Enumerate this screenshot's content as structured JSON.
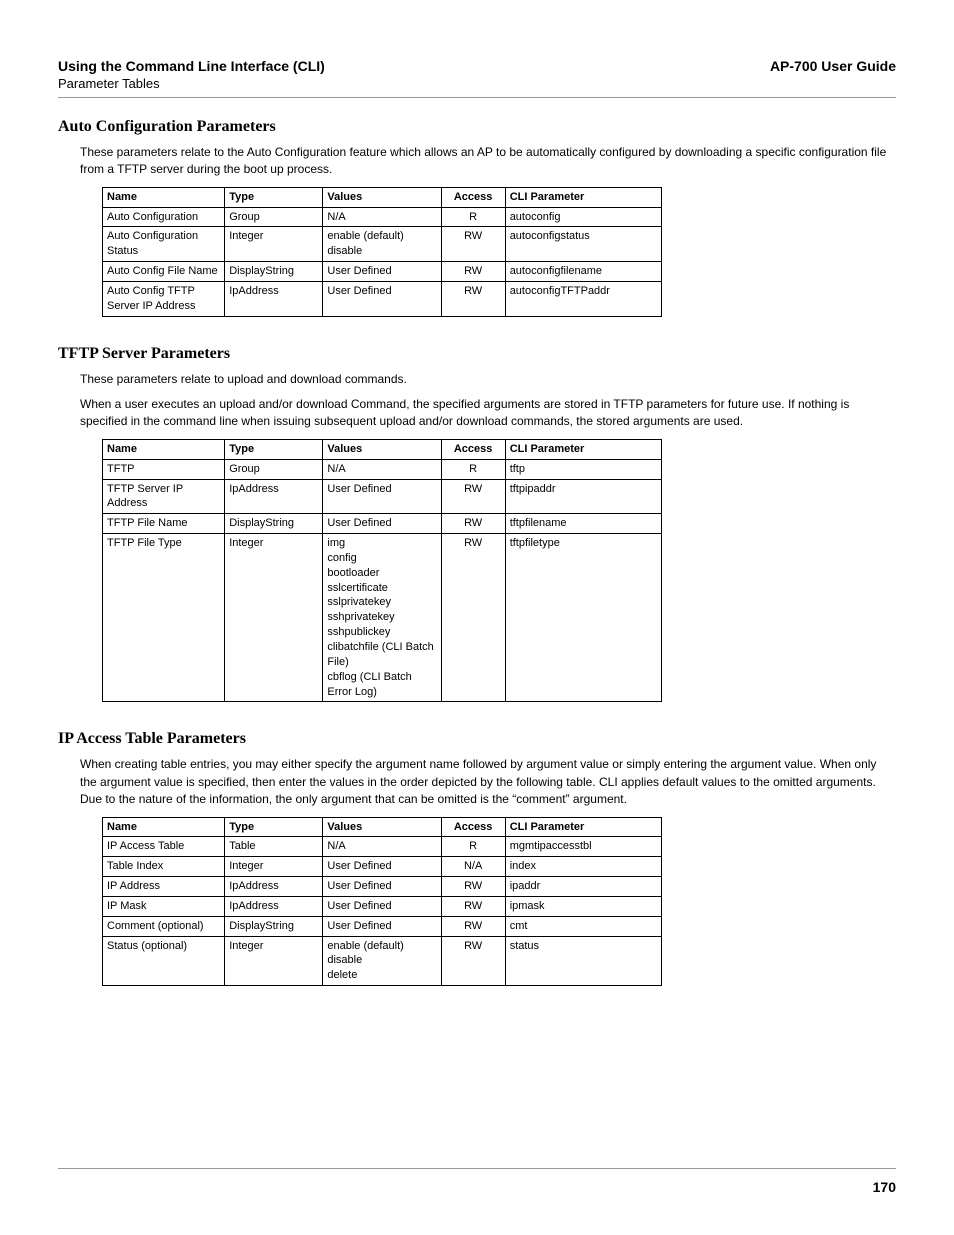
{
  "header": {
    "left_title": "Using the Command Line Interface (CLI)",
    "left_subtitle": "Parameter Tables",
    "right": "AP-700 User Guide"
  },
  "sections": [
    {
      "heading": "Auto Configuration Parameters",
      "paras": [
        "These parameters relate to the Auto Configuration feature which allows an AP to be automatically configured by downloading a specific configuration file from a TFTP server during the boot up process."
      ],
      "cols": [
        "Name",
        "Type",
        "Values",
        "Access",
        "CLI Parameter"
      ],
      "rows": [
        [
          "Auto Configuration",
          "Group",
          "N/A",
          "R",
          "autoconfig"
        ],
        [
          "Auto Configuration Status",
          "Integer",
          "enable (default)\ndisable",
          "RW",
          "autoconfigstatus"
        ],
        [
          "Auto Config File Name",
          "DisplayString",
          "User Defined",
          "RW",
          "autoconfigfilename"
        ],
        [
          "Auto Config TFTP Server IP Address",
          "IpAddress",
          "User Defined",
          "RW",
          "autoconfigTFTPaddr"
        ]
      ]
    },
    {
      "heading": "TFTP Server Parameters",
      "paras": [
        "These parameters relate to upload and download commands.",
        "When a user executes an upload and/or download Command, the specified arguments are stored in TFTP parameters for future use. If nothing is specified in the command line when issuing subsequent upload and/or download commands, the stored arguments are used."
      ],
      "cols": [
        "Name",
        "Type",
        "Values",
        "Access",
        "CLI Parameter"
      ],
      "rows": [
        [
          "TFTP",
          "Group",
          "N/A",
          "R",
          "tftp"
        ],
        [
          "TFTP Server IP Address",
          "IpAddress",
          "User Defined",
          "RW",
          "tftpipaddr"
        ],
        [
          "TFTP File Name",
          "DisplayString",
          "User Defined",
          "RW",
          "tftpfilename"
        ],
        [
          "TFTP File Type",
          "Integer",
          "img\nconfig\nbootloader\nsslcertificate\nsslprivatekey\nsshprivatekey\nsshpublickey\nclibatchfile (CLI Batch File)\ncbflog (CLI Batch Error Log)",
          "RW",
          "tftpfiletype"
        ]
      ]
    },
    {
      "heading": "IP Access Table Parameters",
      "paras": [
        "When creating table entries, you may either specify the argument name followed by argument value or simply entering the argument value. When only the argument value is specified, then enter the values in the order depicted by the following table. CLI applies default values to the omitted arguments. Due to the nature of the information, the only argument that can be omitted is the “comment” argument."
      ],
      "cols": [
        "Name",
        "Type",
        "Values",
        "Access",
        "CLI Parameter"
      ],
      "rows": [
        [
          "IP Access Table",
          "Table",
          "N/A",
          "R",
          "mgmtipaccesstbl"
        ],
        [
          "Table Index",
          "Integer",
          "User Defined",
          "N/A",
          "index"
        ],
        [
          "IP Address",
          "IpAddress",
          "User Defined",
          "RW",
          "ipaddr"
        ],
        [
          "IP Mask",
          "IpAddress",
          "User Defined",
          "RW",
          "ipmask"
        ],
        [
          "Comment (optional)",
          "DisplayString",
          "User Defined",
          "RW",
          "cmt"
        ],
        [
          "Status (optional)",
          "Integer",
          "enable (default)\ndisable\ndelete",
          "RW",
          "status"
        ]
      ]
    }
  ],
  "page_number": "170"
}
